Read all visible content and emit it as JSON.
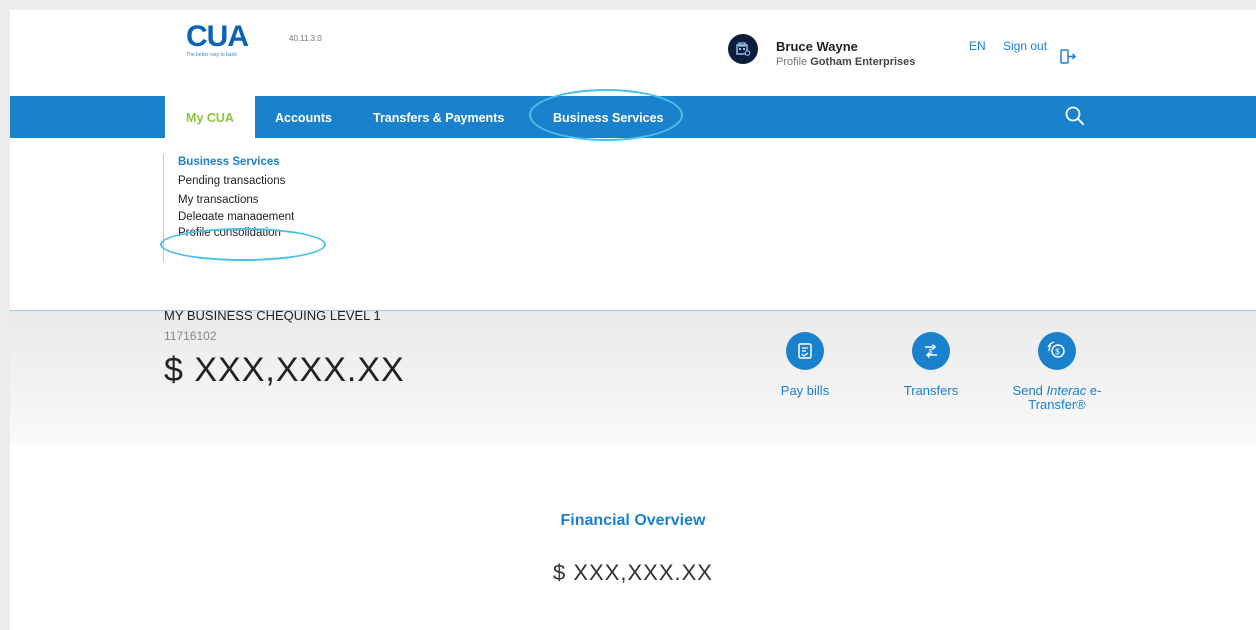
{
  "header": {
    "logo": "CUA",
    "logo_tagline": "The better way to bank",
    "version": "40.11.3.0",
    "user_name": "Bruce Wayne",
    "profile_label": "Profile",
    "profile_name": "Gotham Enterprises",
    "language": "EN",
    "sign_out": "Sign out"
  },
  "nav": {
    "items": [
      "My CUA",
      "Accounts",
      "Transfers & Payments",
      "Business Services"
    ],
    "active_index": 0
  },
  "submenu": {
    "title": "Business Services",
    "items": [
      "Pending transactions",
      "My transactions",
      "Delegate management",
      "Profile consolidation"
    ]
  },
  "account": {
    "name": "MY BUSINESS CHEQUING LEVEL 1",
    "number": "11716102",
    "balance": "$ XXX,XXX.XX"
  },
  "actions": [
    {
      "label": "Pay bills"
    },
    {
      "label": "Transfers"
    },
    {
      "label_pre": "Send ",
      "label_em": "Interac",
      "label_post": " e-Transfer®"
    }
  ],
  "overview": {
    "title": "Financial Overview",
    "amount": "$ XXX,XXX.XX"
  },
  "colors": {
    "brand_blue": "#1a82cc",
    "accent_green": "#8cc540",
    "annotation": "#49c0e6"
  }
}
